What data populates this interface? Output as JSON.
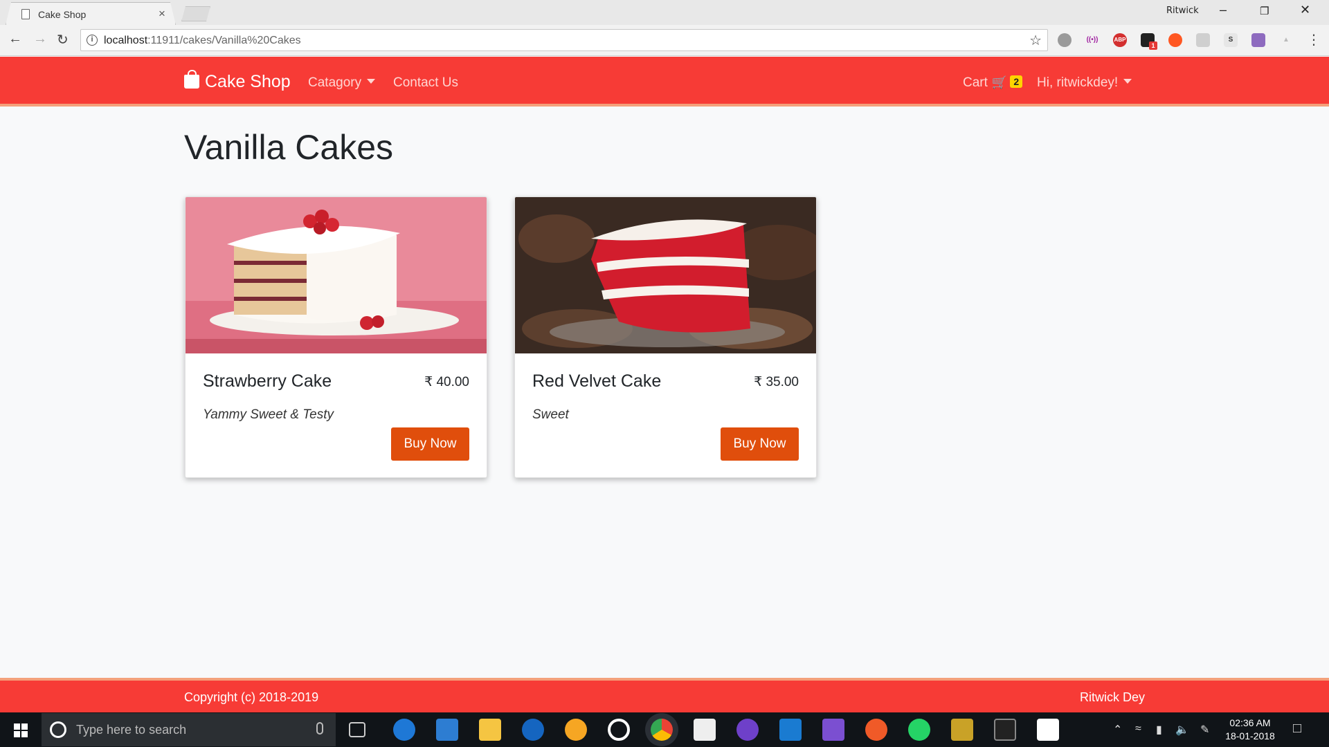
{
  "browser": {
    "tab_title": "Cake Shop",
    "tab_close": "×",
    "profile_name": "Ritwick",
    "url_host": "localhost",
    "url_rest": ":11911/cakes/Vanilla%20Cakes",
    "ext_abp": "ABP",
    "ext_badge": "1",
    "ext_s": "S"
  },
  "navbar": {
    "brand": "Cake Shop",
    "category": "Catagory",
    "contact": "Contact Us",
    "cart_label": "Cart",
    "cart_count": "2",
    "greeting": "Hi, ritwickdey!"
  },
  "page": {
    "title": "Vanilla Cakes"
  },
  "cakes": [
    {
      "name": "Strawberry Cake",
      "price": "₹ 40.00",
      "description": "Yammy Sweet & Testy",
      "button": "Buy Now"
    },
    {
      "name": "Red Velvet Cake",
      "price": "₹ 35.00",
      "description": "Sweet",
      "button": "Buy Now"
    }
  ],
  "footer": {
    "copyright": "Copyright (c) 2018-2019",
    "author": "Ritwick Dey"
  },
  "taskbar": {
    "search_placeholder": "Type here to search",
    "time": "02:36 AM",
    "date": "18-01-2018"
  }
}
